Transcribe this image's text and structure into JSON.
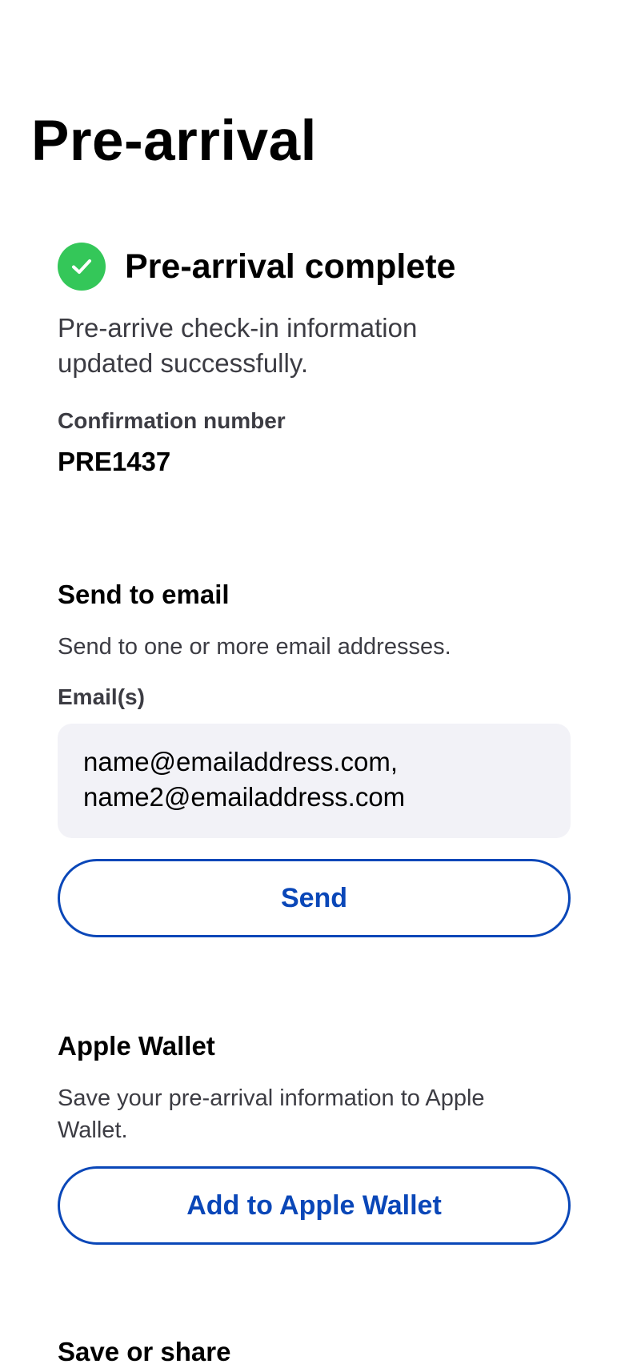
{
  "page": {
    "title": "Pre-arrival"
  },
  "status": {
    "icon": "checkmark-circle-icon",
    "color": "#34c759",
    "title": "Pre-arrival complete",
    "description": "Pre-arrive check-in information updated successfully."
  },
  "confirmation": {
    "label": "Confirmation number",
    "value": "PRE1437"
  },
  "send_email": {
    "title": "Send to email",
    "description": "Send to one or more email addresses.",
    "field_label": "Email(s)",
    "field_value": "name@emailaddress.com,\nname2@emailaddress.com",
    "button_label": "Send"
  },
  "apple_wallet": {
    "title": "Apple Wallet",
    "description": "Save your pre-arrival information to Apple Wallet.",
    "button_label": "Add to Apple Wallet"
  },
  "save_share": {
    "title": "Save or share"
  },
  "colors": {
    "accent": "#0a47b8",
    "success": "#34c759",
    "field_background": "#f2f2f7"
  }
}
